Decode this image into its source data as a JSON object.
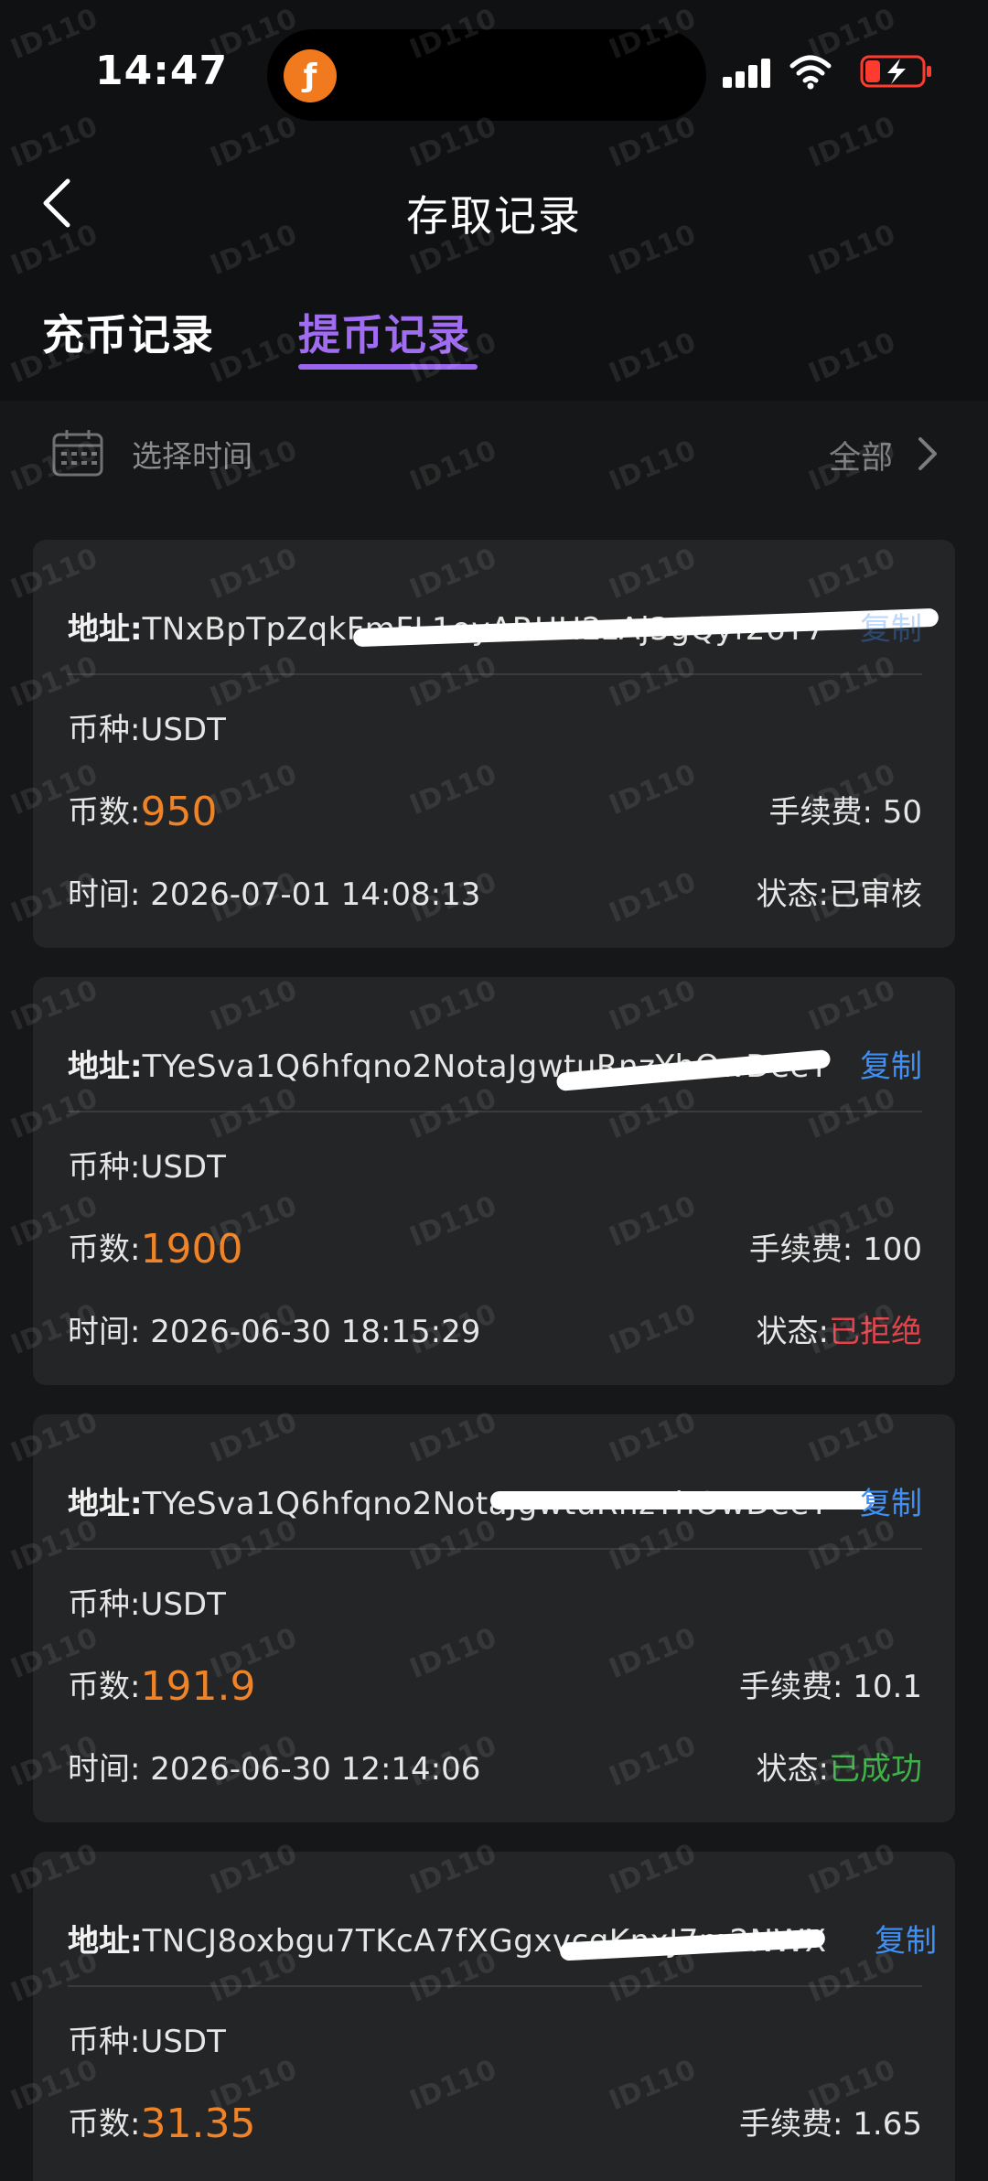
{
  "status_bar": {
    "time": "14:47",
    "icons": [
      "app-logo-icon",
      "signal-icon",
      "wifi-icon",
      "battery-charging-icon"
    ]
  },
  "nav": {
    "back_icon": "chevron-left-icon",
    "title": "存取记录"
  },
  "tabs": [
    {
      "label": "充币记录",
      "active": false
    },
    {
      "label": "提币记录",
      "active": true
    }
  ],
  "filter": {
    "icon": "calendar-icon",
    "label": "选择时间",
    "value": "全部",
    "chevron": "chevron-right-icon"
  },
  "labels": {
    "address": "地址:",
    "currency": "币种:",
    "amount": "币数:",
    "fee": "手续费:",
    "time": "时间:",
    "status": "状态:",
    "copy": "复制"
  },
  "records": [
    {
      "address": "TNxBpTpZqkFmFL1oyARHH2zAj3gQyf26Y7",
      "currency": "USDT",
      "amount": "950",
      "fee": "50",
      "time": "2026-07-01 14:08:13",
      "status": "已审核"
    },
    {
      "address": "TYeSva1Q6hfqno2NotaJgwtuRnzYhOwDeeT",
      "currency": "USDT",
      "amount": "1900",
      "fee": "100",
      "time": "2026-06-30 18:15:29",
      "status": "已拒绝"
    },
    {
      "address": "TYeSva1Q6hfqno2NotaJgwtuRnzYhOwDeeT",
      "currency": "USDT",
      "amount": "191.9",
      "fee": "10.1",
      "time": "2026-06-30 12:14:06",
      "status": "已成功"
    },
    {
      "address": "TNCJ8oxbgu7TKcA7fXGgxvcqKnxJ7m2NWX",
      "currency": "USDT",
      "amount": "31.35",
      "fee": "1.65"
    }
  ],
  "colors": {
    "accent": "#9a66ee",
    "amount": "#f08326",
    "link": "#3f8ff5",
    "rejected": "#e2424a",
    "success": "#3fb04a"
  }
}
